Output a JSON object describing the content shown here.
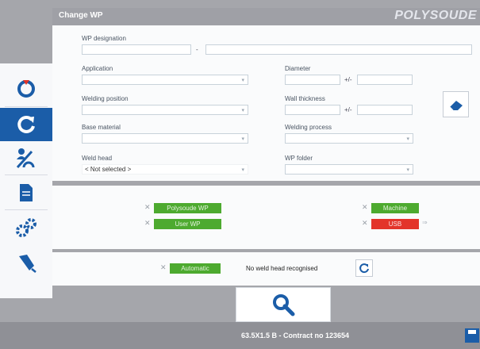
{
  "header": {
    "title": "Change WP",
    "brand": "POLYSOUDE"
  },
  "form": {
    "wp_designation_label": "WP designation",
    "wp_designation_separator": "-",
    "application_label": "Application",
    "diameter_label": "Diameter",
    "plus_minus": "+/-",
    "welding_position_label": "Welding position",
    "wall_thickness_label": "Wall thickness",
    "base_material_label": "Base material",
    "welding_process_label": "Welding process",
    "weld_head_label": "Weld head",
    "weld_head_value": "< Not selected >",
    "wp_folder_label": "WP folder"
  },
  "filters": {
    "polysoude_wp": "Polysoude WP",
    "user_wp": "User WP",
    "machine": "Machine",
    "usb": "USB",
    "automatic": "Automatic",
    "check_mark": "✕"
  },
  "connection": {
    "status": "No weld head recognised"
  },
  "footer": {
    "contract": "63.5X1.5 B - Contract no 123654"
  },
  "colors": {
    "accent": "#1b5da8",
    "green": "#4daa2f",
    "red": "#e3342a"
  },
  "icons": [
    "program-icon",
    "refresh-cycle-icon",
    "weld-head-icon",
    "document-icon",
    "settings-gears-icon",
    "probe-icon",
    "eraser-icon",
    "search-icon",
    "refresh-icon",
    "save-disk-icon"
  ]
}
